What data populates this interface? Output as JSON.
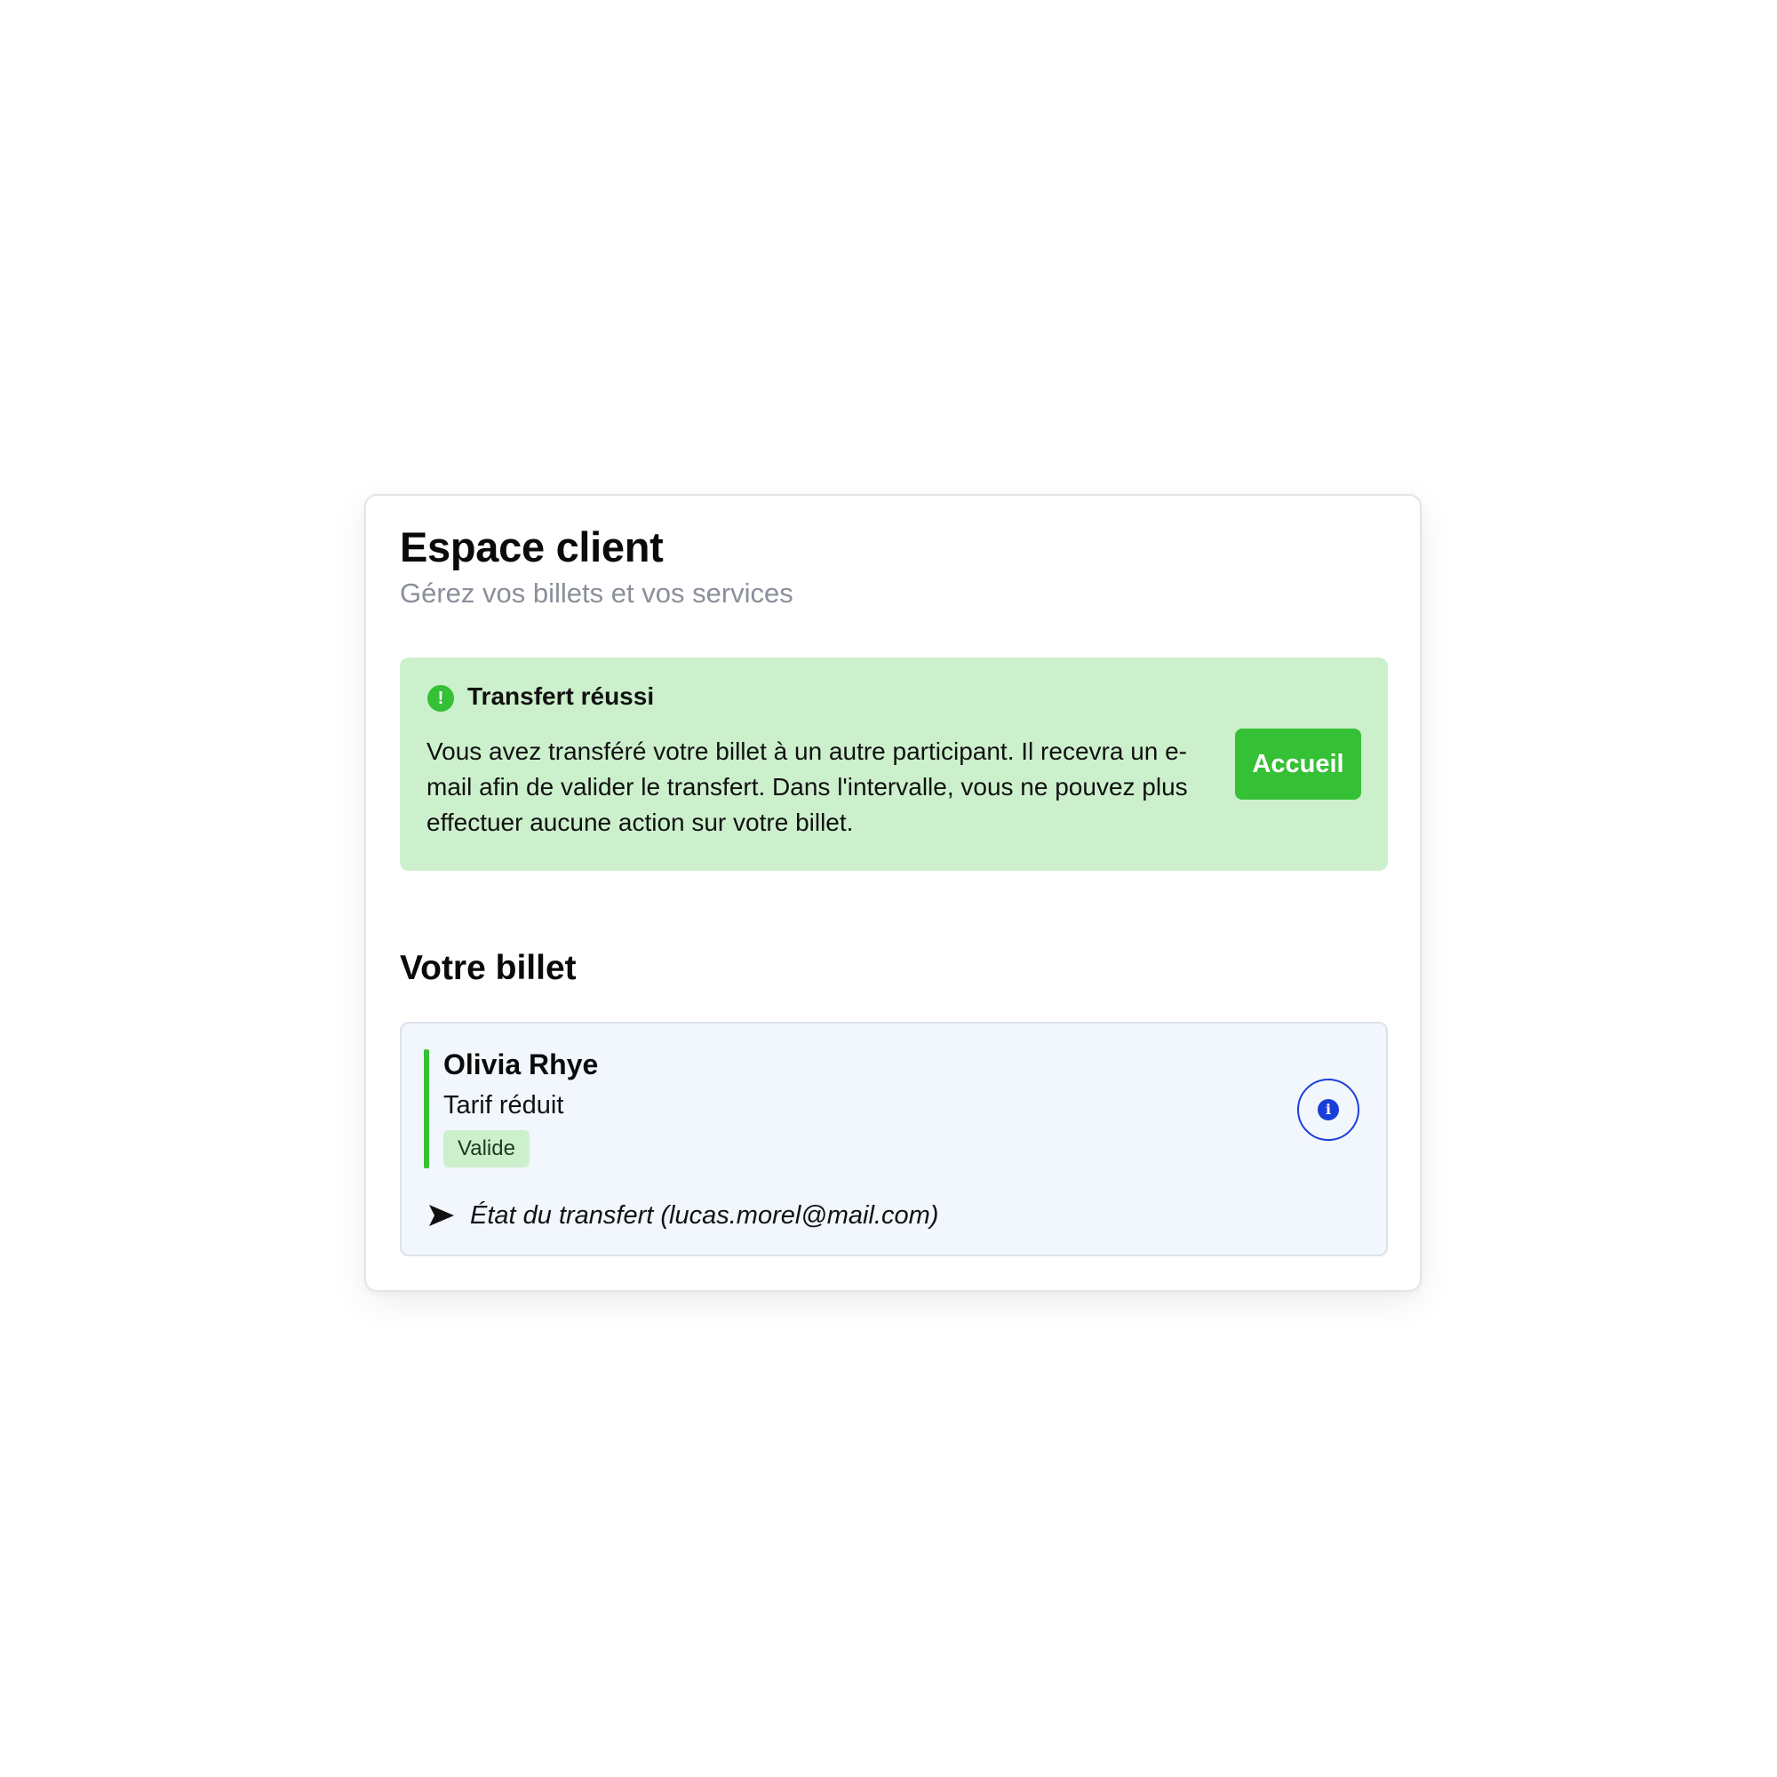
{
  "header": {
    "title": "Espace client",
    "subtitle": "Gérez vos billets et vos services"
  },
  "alert": {
    "icon": "exclamation-circle-icon",
    "title": "Transfert réussi",
    "message": "Vous avez transféré votre billet à un autre participant. Il recevra un e-mail afin de valider le transfert. Dans l'intervalle, vous ne pouvez plus effectuer aucune action sur votre billet.",
    "button_label": "Accueil"
  },
  "ticket_section": {
    "title": "Votre billet",
    "ticket": {
      "holder_name": "Olivia Rhye",
      "rate": "Tarif réduit",
      "status": "Valide",
      "info_icon": "info-icon",
      "transfer_icon": "send-icon",
      "transfer_label": "État du transfert (lucas.morel@mail.com)"
    }
  },
  "colors": {
    "accent_green": "#35c035",
    "alert_background": "#ccf0cc",
    "info_blue": "#1a3fd9",
    "ticket_background": "#f2f6fd",
    "subtitle_gray": "#8a8f99"
  }
}
